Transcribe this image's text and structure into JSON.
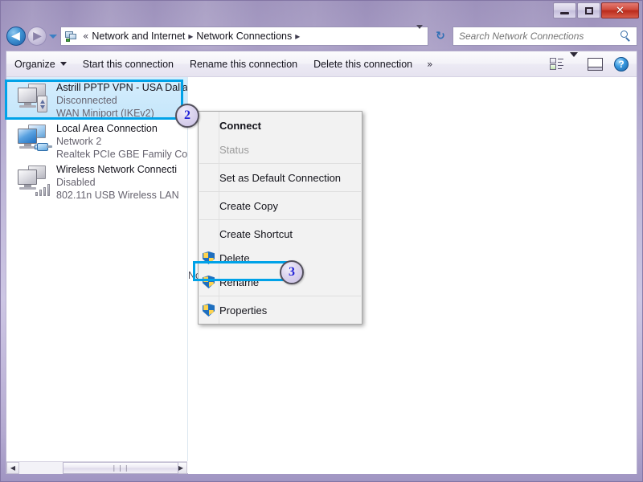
{
  "window": {
    "controls": {
      "minimize": "minimize-button",
      "maximize": "maximize-button",
      "close": "✕"
    }
  },
  "addressbar": {
    "back_glyph": "◀",
    "forward_glyph": "▶",
    "breadcrumbs": [
      "Network and Internet",
      "Network Connections"
    ],
    "leading_separator": "«",
    "separator": "▸",
    "refresh_glyph": "↻",
    "icon": "network-folder-icon"
  },
  "search": {
    "placeholder": "Search Network Connections",
    "value": "",
    "icon": "search-icon"
  },
  "toolbar": {
    "organize": "Organize",
    "start_connection": "Start this connection",
    "rename_connection": "Rename this connection",
    "delete_connection": "Delete this connection",
    "overflow": "»",
    "view_icon": "change-view-icon",
    "preview_icon": "preview-pane-icon",
    "help_icon": "help-icon",
    "help_glyph": "?"
  },
  "connections": [
    {
      "name": "Astrill PPTP VPN - USA Dalla",
      "status": "Disconnected",
      "device": "WAN Miniport (IKEv2)",
      "icon": "vpn-connection-icon",
      "selected": true
    },
    {
      "name": "Local Area Connection",
      "status": "Network  2",
      "device": "Realtek PCIe GBE Family Co",
      "icon": "lan-connection-icon",
      "selected": false
    },
    {
      "name": "Wireless Network Connecti",
      "status": "Disabled",
      "device": "802.11n USB Wireless LAN ",
      "icon": "wireless-connection-icon",
      "selected": false
    }
  ],
  "context_menu": {
    "items": [
      {
        "label": "Connect",
        "bold": true,
        "disabled": false,
        "shield": false,
        "separator_after": false,
        "highlighted": false
      },
      {
        "label": "Status",
        "bold": false,
        "disabled": true,
        "shield": false,
        "separator_after": true,
        "highlighted": false
      },
      {
        "label": "Set as Default Connection",
        "bold": false,
        "disabled": false,
        "shield": false,
        "separator_after": true,
        "highlighted": false
      },
      {
        "label": "Create Copy",
        "bold": false,
        "disabled": false,
        "shield": false,
        "separator_after": true,
        "highlighted": false
      },
      {
        "label": "Create Shortcut",
        "bold": false,
        "disabled": false,
        "shield": false,
        "separator_after": false,
        "highlighted": false
      },
      {
        "label": "Delete",
        "bold": false,
        "disabled": false,
        "shield": true,
        "separator_after": false,
        "highlighted": false
      },
      {
        "label": "Rename",
        "bold": false,
        "disabled": false,
        "shield": true,
        "separator_after": true,
        "highlighted": false
      },
      {
        "label": "Properties",
        "bold": false,
        "disabled": false,
        "shield": true,
        "separator_after": false,
        "highlighted": true
      }
    ]
  },
  "preview": {
    "message": "No preview available."
  },
  "scrollbar": {
    "left_glyph": "◀",
    "right_glyph": "▶",
    "thumb_grip": "❘❘❘"
  },
  "annotations": {
    "badges": [
      {
        "number": "2",
        "target": "selected-connection"
      },
      {
        "number": "3",
        "target": "properties-menu-item"
      }
    ],
    "highlight_color": "#00a2e8",
    "badge_text_color": "#2323d8"
  }
}
